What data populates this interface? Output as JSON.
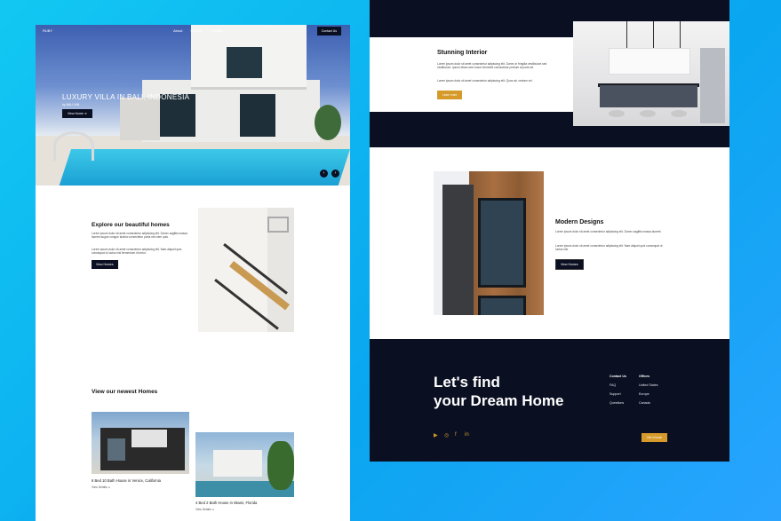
{
  "left_page": {
    "nav": {
      "logo": "RUBY",
      "links": [
        "About",
        "Homes",
        "Portfolio"
      ],
      "contact_button": "Contact Us"
    },
    "hero": {
      "title": "LUXURY VILLA IN BALI, INDONESIA",
      "subtitle": "by BALI INN",
      "button": "View Home",
      "prev_icon": "arrow-left-icon",
      "next_icon": "arrow-right-icon"
    },
    "explore": {
      "title": "Explore our beautiful homes",
      "text1": "Lorem ipsum dolor sit amet consectetur adipiscing elit. Donec sagittis massa laoreet augue congue lacinia consectetur porta nec sem quis.",
      "text2": "Lorem ipsum dolor sit amet consectetur adipiscing elit. Nam aliquet quis consequat ut luctus nisi fermentum id tortor.",
      "button": "View Homes"
    },
    "newest": {
      "title": "View our newest Homes",
      "homes": [
        {
          "caption": "6 Bed 10 Bath House in Venice, California",
          "link": "View Details"
        },
        {
          "caption": "4 Bed 2 Bath House in Miami, Florida",
          "link": "View Details"
        }
      ]
    }
  },
  "right_page": {
    "interior": {
      "title": "Stunning Interior",
      "text1": "Lorem ipsum dolor sit amet consectetur adipiscing elit. Donec in fringilla vestibulum sed vestibulum. Ipsum etiam sem fusce hendrerit consectetur pretium at porta sit.",
      "text2": "Lorem ipsum dolor sit amet consectetur adipiscing elit. Quos ab, veniam vel.",
      "button": "Learn more"
    },
    "modern": {
      "title": "Modern Designs",
      "text1": "Lorem ipsum dolor sit amet consectetur adipiscing elit. Donec sagittis massa laoreet.",
      "text2": "Lorem ipsum dolor sit amet consectetur adipiscing elit. Nam aliquet quis consequat ut luctus nisi.",
      "button": "View Homes"
    },
    "footer": {
      "headline_line1": "Let's find",
      "headline_line2": "your Dream Home",
      "contact_head": "Contact Us",
      "contact_items": [
        "FAQ",
        "Support",
        "Questions"
      ],
      "offices_head": "Offices",
      "offices_items": [
        "United States",
        "Europe",
        "Canada"
      ],
      "social_icons": [
        "youtube-icon",
        "instagram-icon",
        "facebook-icon",
        "linkedin-icon"
      ],
      "cta_button": "Get in touch"
    }
  },
  "colors": {
    "background": "#12c8f2",
    "navy": "#0b0f22",
    "gold": "#d69a2a"
  }
}
